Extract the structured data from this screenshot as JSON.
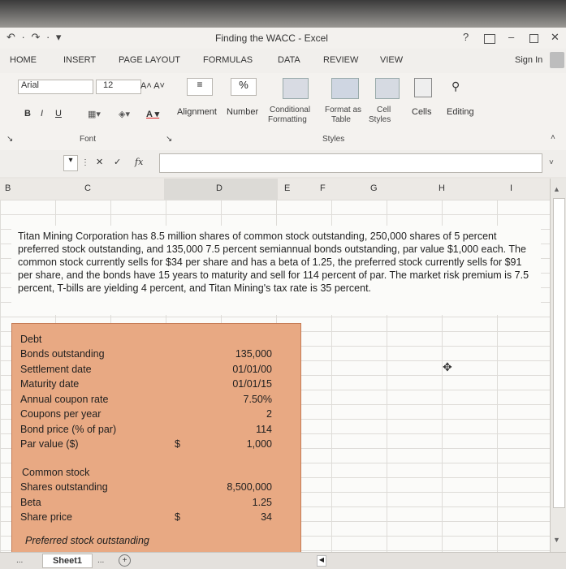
{
  "window": {
    "title": "Finding the WACC - Excel",
    "help": "?",
    "minimize": "–",
    "close": "✕"
  },
  "tabs": [
    "HOME",
    "INSERT",
    "PAGE LAYOUT",
    "FORMULAS",
    "DATA",
    "REVIEW",
    "VIEW"
  ],
  "signin": "Sign In",
  "ribbon": {
    "font_name": "Arial",
    "font_size": "12",
    "bold": "B",
    "italic": "I",
    "underline": "U",
    "font_group": "Font",
    "alignment": "Alignment",
    "number": "Number",
    "percent": "%",
    "conditional": "Conditional",
    "formatting": "Formatting",
    "format_as": "Format as",
    "table": "Table",
    "cell": "Cell",
    "styles_btn": "Styles",
    "styles_group": "Styles",
    "cells": "Cells",
    "editing": "Editing"
  },
  "formula_bar": {
    "cancel": "✕",
    "enter": "✓",
    "fx": "fx",
    "content": ""
  },
  "columns": [
    "B",
    "C",
    "D",
    "E",
    "F",
    "G",
    "H",
    "I"
  ],
  "problem_text": "Titan Mining Corporation has 8.5 million shares of common stock outstanding, 250,000 shares of 5 percent preferred stock outstanding, and 135,000 7.5 percent semiannual bonds outstanding, par value $1,000 each. The common stock currently sells for $34 per share and has a beta of 1.25, the preferred stock currently sells for $91 per share, and the bonds have 15 years to maturity and sell for 114 percent of par. The market risk premium is 7.5 percent, T-bills are yielding 4 percent, and Titan Mining's tax rate is 35 percent.",
  "debt": {
    "heading": "Debt",
    "rows": [
      {
        "label": "Bonds outstanding",
        "value": "135,000",
        "dollar": ""
      },
      {
        "label": "Settlement date",
        "value": "01/01/00",
        "dollar": ""
      },
      {
        "label": "Maturity date",
        "value": "01/01/15",
        "dollar": ""
      },
      {
        "label": "Annual coupon rate",
        "value": "7.50%",
        "dollar": ""
      },
      {
        "label": "Coupons per year",
        "value": "2",
        "dollar": ""
      },
      {
        "label": "Bond price (% of par)",
        "value": "114",
        "dollar": ""
      },
      {
        "label": "Par value ($)",
        "value": "1,000",
        "dollar": "$"
      }
    ]
  },
  "common": {
    "heading": "Common stock",
    "rows": [
      {
        "label": "Shares outstanding",
        "value": "8,500,000",
        "dollar": ""
      },
      {
        "label": "Beta",
        "value": "1.25",
        "dollar": ""
      },
      {
        "label": "Share price",
        "value": "34",
        "dollar": "$"
      }
    ]
  },
  "preferred": {
    "heading": "Preferred stock outstanding"
  },
  "bottom": {
    "sheet_tab": "Sheet1",
    "ellipsis": "...",
    "add": "+"
  }
}
